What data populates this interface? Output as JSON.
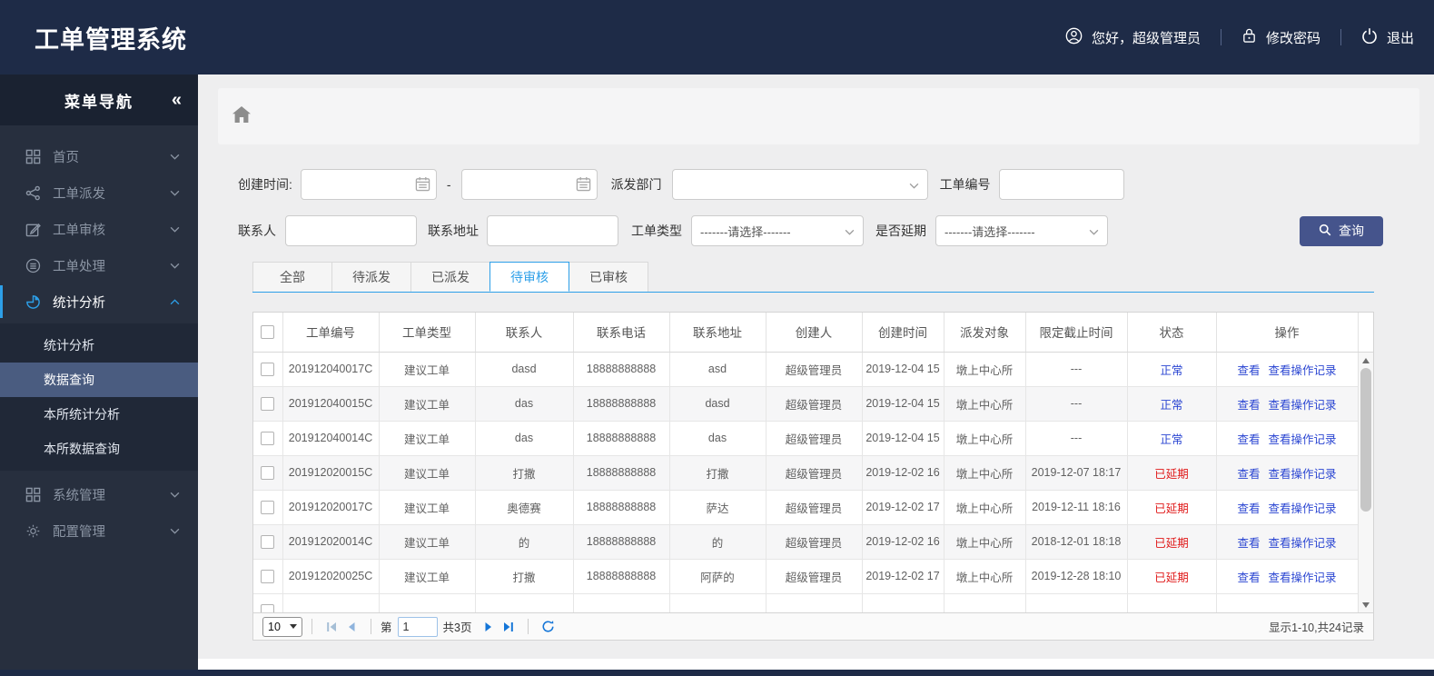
{
  "header": {
    "title": "工单管理系统",
    "greeting": "您好，超级管理员",
    "change_password": "修改密码",
    "logout": "退出"
  },
  "sidebar": {
    "title": "菜单导航",
    "collapse_glyph": "«",
    "items": [
      {
        "label": "首页"
      },
      {
        "label": "工单派发"
      },
      {
        "label": "工单审核"
      },
      {
        "label": "工单处理"
      },
      {
        "label": "统计分析",
        "active": true,
        "expanded": true
      },
      {
        "label": "系统管理"
      },
      {
        "label": "配置管理"
      }
    ],
    "submenu": [
      {
        "label": "统计分析"
      },
      {
        "label": "数据查询",
        "selected": true
      },
      {
        "label": "本所统计分析"
      },
      {
        "label": "本所数据查询"
      }
    ]
  },
  "filters": {
    "created_label": "创建时间:",
    "range_dash": "-",
    "dept_label": "派发部门",
    "dept_value": "",
    "order_no_label": "工单编号",
    "order_no_value": "",
    "contact_label": "联系人",
    "contact_value": "",
    "address_label": "联系地址",
    "address_value": "",
    "type_label": "工单类型",
    "type_value": "-------请选择-------",
    "delay_label": "是否延期",
    "delay_value": "-------请选择-------",
    "search_label": "查询"
  },
  "tabs": [
    {
      "label": "全部"
    },
    {
      "label": "待派发"
    },
    {
      "label": "已派发"
    },
    {
      "label": "待审核",
      "active": true
    },
    {
      "label": "已审核"
    }
  ],
  "table": {
    "columns": [
      "工单编号",
      "工单类型",
      "联系人",
      "联系电话",
      "联系地址",
      "创建人",
      "创建时间",
      "派发对象",
      "限定截止时间",
      "状态",
      "操作"
    ],
    "action_view": "查看",
    "action_log": "查看操作记录",
    "rows": [
      {
        "order_no": "201912040017C",
        "type": "建议工单",
        "contact": "dasd",
        "phone": "18888888888",
        "address": "asd",
        "creator": "超级管理员",
        "created": "2019-12-04 15",
        "dispatch": "墩上中心所",
        "deadline": "---",
        "status": "正常"
      },
      {
        "order_no": "201912040015C",
        "type": "建议工单",
        "contact": "das",
        "phone": "18888888888",
        "address": "dasd",
        "creator": "超级管理员",
        "created": "2019-12-04 15",
        "dispatch": "墩上中心所",
        "deadline": "---",
        "status": "正常"
      },
      {
        "order_no": "201912040014C",
        "type": "建议工单",
        "contact": "das",
        "phone": "18888888888",
        "address": "das",
        "creator": "超级管理员",
        "created": "2019-12-04 15",
        "dispatch": "墩上中心所",
        "deadline": "---",
        "status": "正常"
      },
      {
        "order_no": "201912020015C",
        "type": "建议工单",
        "contact": "打撒",
        "phone": "18888888888",
        "address": "打撒",
        "creator": "超级管理员",
        "created": "2019-12-02 16",
        "dispatch": "墩上中心所",
        "deadline": "2019-12-07 18:17",
        "status": "已延期"
      },
      {
        "order_no": "201912020017C",
        "type": "建议工单",
        "contact": "奥德赛",
        "phone": "18888888888",
        "address": "萨达",
        "creator": "超级管理员",
        "created": "2019-12-02 17",
        "dispatch": "墩上中心所",
        "deadline": "2019-12-11 18:16",
        "status": "已延期"
      },
      {
        "order_no": "201912020014C",
        "type": "建议工单",
        "contact": "的",
        "phone": "18888888888",
        "address": "的",
        "creator": "超级管理员",
        "created": "2019-12-02 16",
        "dispatch": "墩上中心所",
        "deadline": "2018-12-01 18:18",
        "status": "已延期"
      },
      {
        "order_no": "201912020025C",
        "type": "建议工单",
        "contact": "打撒",
        "phone": "18888888888",
        "address": "阿萨的",
        "creator": "超级管理员",
        "created": "2019-12-02 17",
        "dispatch": "墩上中心所",
        "deadline": "2019-12-28 18:10",
        "status": "已延期"
      }
    ]
  },
  "pagination": {
    "page_size": "10",
    "page_prefix": "第",
    "current_page": "1",
    "total_pages": "共3页",
    "info": "显示1-10,共24记录"
  },
  "colors": {
    "topbar_bg": "#1e2b47",
    "sidebar_bg": "#272f3e",
    "submenu_selected_bg": "#4a5c80",
    "accent_blue": "#2d9fe8",
    "link_blue": "#2b46d2",
    "danger_red": "#e01a1a",
    "search_button_bg": "#45548c",
    "content_bg": "#eeeeef"
  }
}
